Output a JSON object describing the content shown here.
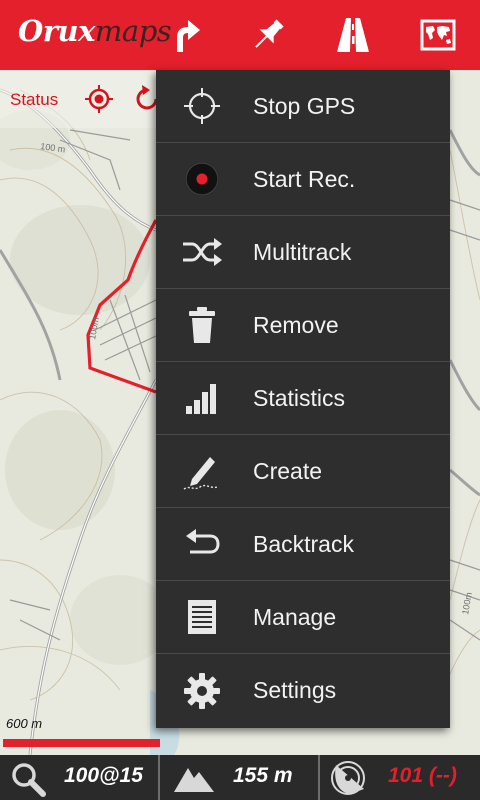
{
  "app": {
    "logo_part1": "Orux",
    "logo_part2": "maps"
  },
  "toolbar": {
    "icons": [
      "route-arrow-icon",
      "pushpin-icon",
      "road-icon",
      "world-map-icon"
    ]
  },
  "status": {
    "label": "Status"
  },
  "map": {
    "contour_labels": [
      "100 m",
      "100m",
      "100m"
    ]
  },
  "menu": {
    "items": [
      {
        "label": "Stop GPS",
        "icon": "crosshair-icon"
      },
      {
        "label": "Start Rec.",
        "icon": "record-icon"
      },
      {
        "label": "Multitrack",
        "icon": "shuffle-icon"
      },
      {
        "label": "Remove",
        "icon": "trash-icon"
      },
      {
        "label": "Statistics",
        "icon": "bar-chart-icon"
      },
      {
        "label": "Create",
        "icon": "pencil-icon"
      },
      {
        "label": "Backtrack",
        "icon": "undo-arrow-icon"
      },
      {
        "label": "Manage",
        "icon": "list-icon"
      },
      {
        "label": "Settings",
        "icon": "gear-icon"
      }
    ]
  },
  "scale": {
    "label": "600 m"
  },
  "bottom": {
    "zoom": "100@15",
    "altitude": "155 m",
    "satellites": "101 (--)"
  },
  "colors": {
    "accent": "#e3202b",
    "menu_bg": "#2e2e2e",
    "bottom_bg": "#2a2a2a",
    "satellites_text": "#e3202b"
  }
}
